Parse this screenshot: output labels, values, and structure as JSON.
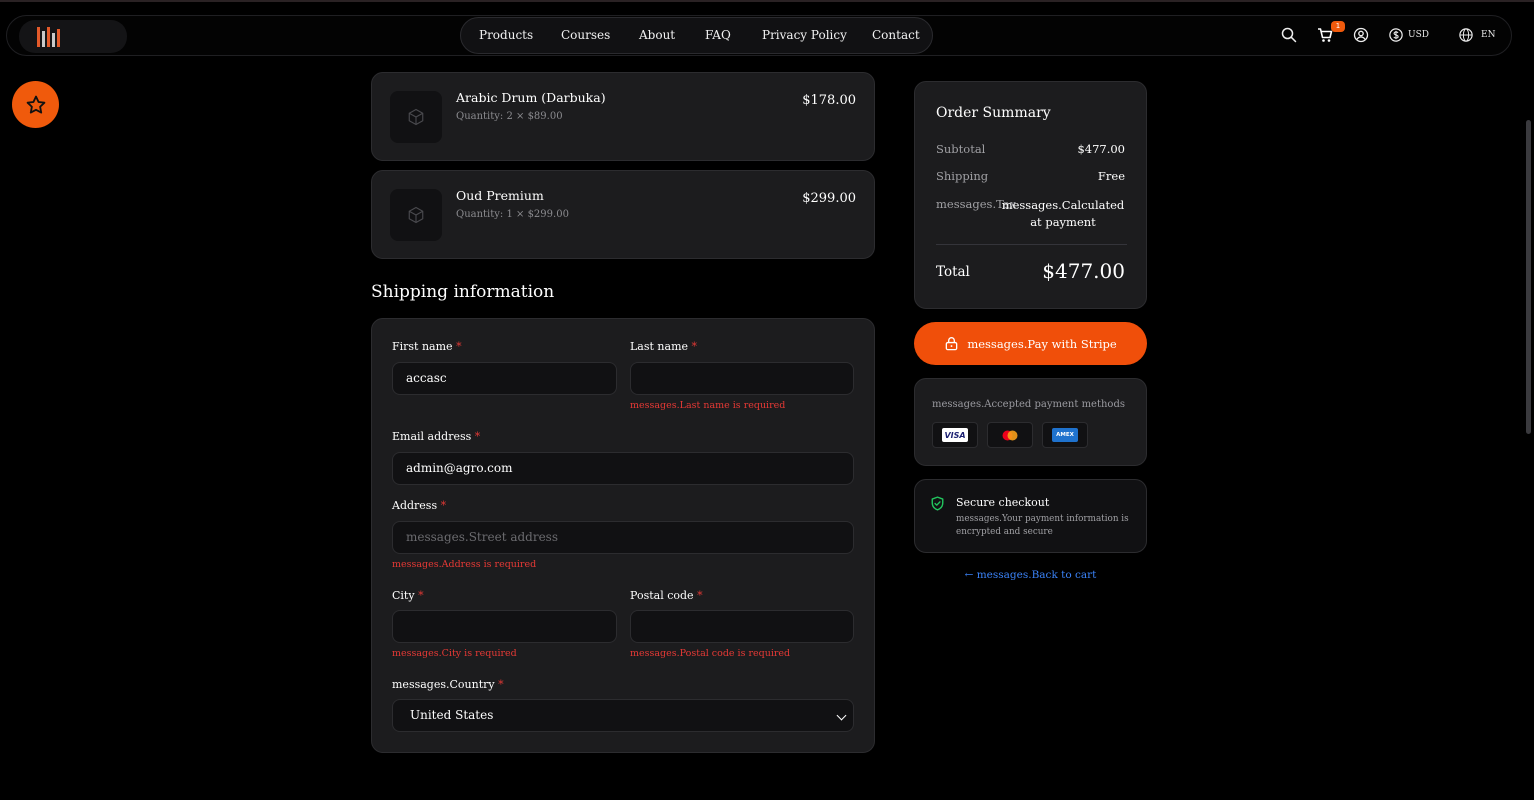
{
  "nav": {
    "items": [
      "Products",
      "Courses",
      "About",
      "FAQ",
      "Privacy Policy",
      "Contact"
    ],
    "cart_count": "1",
    "currency": "USD",
    "language": "EN"
  },
  "cart_items": [
    {
      "name": "Arabic Drum (Darbuka)",
      "quantity": "Quantity: 2 × $89.00",
      "price": "$178.00"
    },
    {
      "name": "Oud Premium",
      "quantity": "Quantity: 1 × $299.00",
      "price": "$299.00"
    }
  ],
  "shipping": {
    "title": "Shipping information",
    "first_name_label": "First name",
    "first_name_value": "accasc",
    "last_name_label": "Last name",
    "last_name_value": "",
    "last_name_error": "messages.Last name is required",
    "email_label": "Email address",
    "email_value": "admin@agro.com",
    "address_label": "Address",
    "address_placeholder": "messages.Street address",
    "address_error": "messages.Address is required",
    "city_label": "City",
    "city_error": "messages.City is required",
    "postal_label": "Postal code",
    "postal_error": "messages.Postal code is required",
    "country_label": "messages.Country",
    "country_value": "United States",
    "required_mark": "*"
  },
  "summary": {
    "title": "Order Summary",
    "subtotal_label": "Subtotal",
    "subtotal_value": "$477.00",
    "shipping_label": "Shipping",
    "shipping_value": "Free",
    "tax_label": "messages.Tax",
    "tax_value": "messages.Calculated at payment",
    "total_label": "Total",
    "total_value": "$477.00"
  },
  "pay_button": "messages.Pay with Stripe",
  "payment_methods": {
    "label": "messages.Accepted payment methods",
    "cards": [
      "VISA",
      "Mastercard",
      "AMEX"
    ]
  },
  "secure": {
    "title": "Secure checkout",
    "desc": "messages.Your payment information is encrypted and secure"
  },
  "back_link": "← messages.Back to cart",
  "colors": {
    "accent": "#f04f0a",
    "error": "#e53935",
    "link": "#3a82f7",
    "secure_green": "#22c55e",
    "card_bg": "#1c1c1e"
  }
}
